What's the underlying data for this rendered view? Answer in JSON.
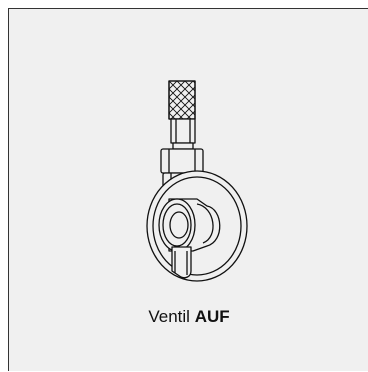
{
  "illustration": {
    "icon": "valve-icon"
  },
  "caption": {
    "prefix": "Ventil",
    "state": "AUF"
  },
  "colors": {
    "panel_background": "#f0f0f0",
    "line": "#111111"
  }
}
